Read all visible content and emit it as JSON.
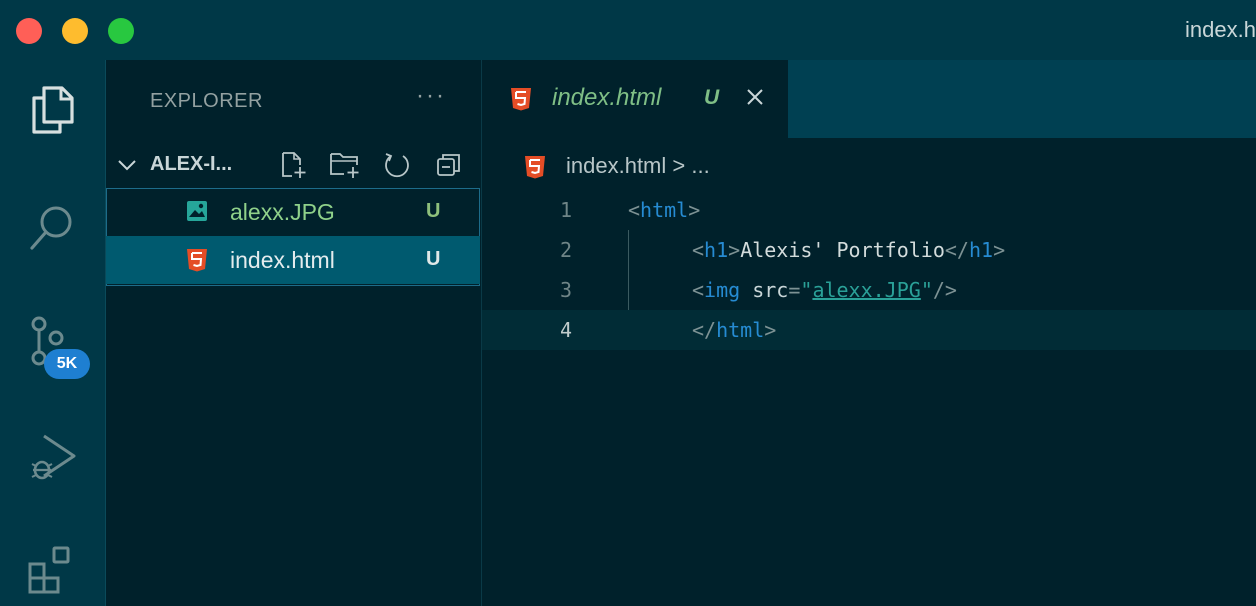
{
  "window": {
    "title": "index.h"
  },
  "activity_bar": {
    "icons": [
      "files-icon",
      "search-icon",
      "source-control-icon",
      "run-debug-icon",
      "extensions-icon"
    ],
    "source_control_badge": "5K",
    "badge_color": "#1e7fd1"
  },
  "explorer": {
    "title": "EXPLORER",
    "more": "···",
    "folder_name": "ALEX-I...",
    "files": [
      {
        "name": "alexx.JPG",
        "status": "U",
        "type": "image"
      },
      {
        "name": "index.html",
        "status": "U",
        "type": "html",
        "selected": true
      }
    ]
  },
  "editor": {
    "tab": {
      "label": "index.html",
      "status": "U",
      "close": "×"
    },
    "breadcrumb": "index.html > ...",
    "lines": [
      {
        "number": "1"
      },
      {
        "number": "2"
      },
      {
        "number": "3"
      },
      {
        "number": "4"
      }
    ],
    "code": {
      "l1_tag": "html",
      "l2_tag": "h1",
      "l2_text": "Alexis' Portfolio",
      "l3_tag": "img",
      "l3_attr": "src",
      "l3_value": "alexx.JPG",
      "l4_tag": "html"
    }
  },
  "colors": {
    "accent_html": "#e44d26",
    "untracked_green": "#8ec07c",
    "tag_blue": "#268bd2",
    "string_teal": "#2aa198"
  }
}
